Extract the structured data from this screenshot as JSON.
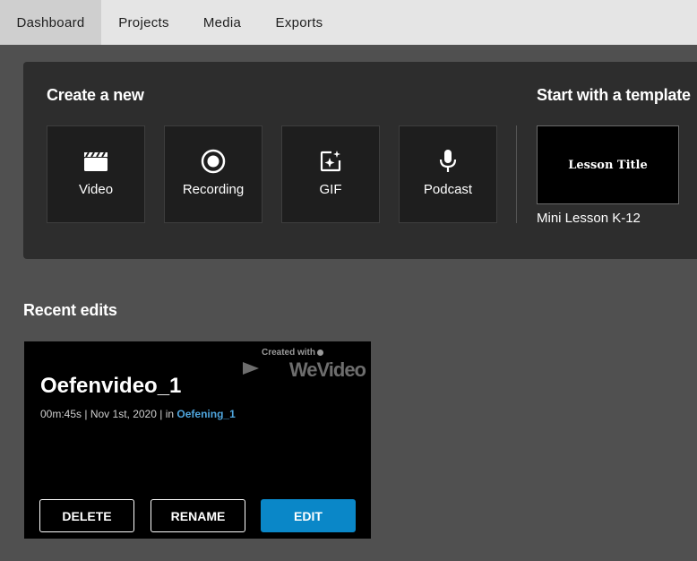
{
  "nav": {
    "tabs": [
      {
        "label": "Dashboard",
        "active": true
      },
      {
        "label": "Projects"
      },
      {
        "label": "Media"
      },
      {
        "label": "Exports"
      }
    ]
  },
  "create": {
    "heading": "Create a new",
    "tiles": [
      {
        "label": "Video",
        "icon": "clapperboard-icon"
      },
      {
        "label": "Recording",
        "icon": "record-icon"
      },
      {
        "label": "GIF",
        "icon": "gif-sparkle-icon"
      },
      {
        "label": "Podcast",
        "icon": "microphone-icon"
      }
    ]
  },
  "template": {
    "heading": "Start with a template",
    "thumb_text": "Lesson Title",
    "name": "Mini Lesson K-12"
  },
  "recent": {
    "heading": "Recent edits",
    "project": {
      "title": "Oefenvideo_1",
      "duration": "00m:45s",
      "date": "Nov 1st, 2020",
      "in_prefix": "in",
      "folder": "Oefening_1",
      "watermark_small": "Created with",
      "watermark_brand": "WeVideo"
    },
    "buttons": {
      "delete": "DELETE",
      "rename": "RENAME",
      "edit": "EDIT"
    }
  },
  "colors": {
    "page_bg": "#505050",
    "panel_bg": "#2d2d2d",
    "nav_bg": "#e5e5e5",
    "nav_active": "#cfcfcf",
    "accent": "#0a87c8",
    "link": "#4fa5dd"
  }
}
